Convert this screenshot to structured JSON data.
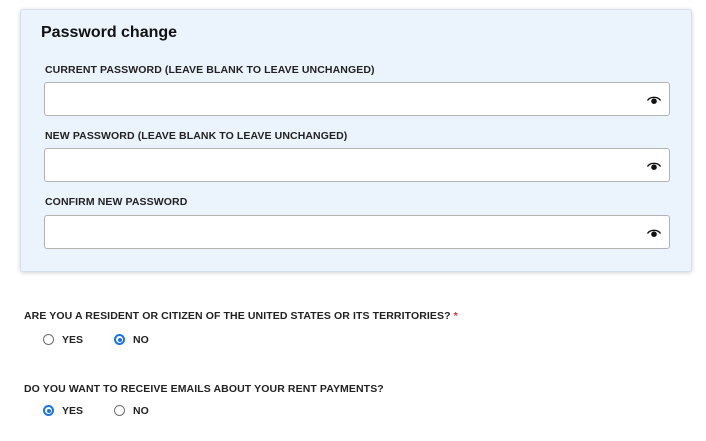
{
  "password_section": {
    "title": "Password change",
    "fields": [
      {
        "label": "CURRENT PASSWORD (LEAVE BLANK TO LEAVE UNCHANGED)",
        "value": "",
        "icon": "eye-icon"
      },
      {
        "label": "NEW PASSWORD (LEAVE BLANK TO LEAVE UNCHANGED)",
        "value": "",
        "icon": "eye-icon"
      },
      {
        "label": "CONFIRM NEW PASSWORD",
        "value": "",
        "icon": "eye-icon"
      }
    ]
  },
  "questions": [
    {
      "text": "ARE YOU A RESIDENT OR CITIZEN OF THE UNITED STATES OR ITS TERRITORIES?",
      "required_marker": "*",
      "options": [
        {
          "label": "YES",
          "selected": false
        },
        {
          "label": "NO",
          "selected": true
        }
      ]
    },
    {
      "text": "DO YOU WANT TO RECEIVE EMAILS ABOUT YOUR RENT PAYMENTS?",
      "options": [
        {
          "label": "YES",
          "selected": true
        },
        {
          "label": "NO",
          "selected": false
        }
      ]
    }
  ],
  "colors": {
    "panel_background": "#ebf4fc",
    "radio_accent": "#1a73e8",
    "required_marker": "#d9342b"
  }
}
